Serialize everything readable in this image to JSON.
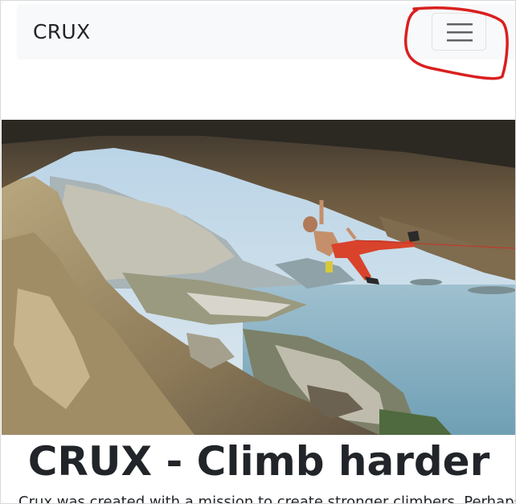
{
  "navbar": {
    "brand": "CRUX",
    "menu_icon": "hamburger-icon"
  },
  "hero": {
    "image_subject": "climber hanging from overhanging cave roof above coastline"
  },
  "content": {
    "heading": "CRUX - Climb harder",
    "intro_text": "Crux was created with a mission to create stronger climbers. Perhaps"
  },
  "colors": {
    "navbar_bg": "#f8f9fa",
    "text": "#212529",
    "annotation": "#d9201f"
  }
}
